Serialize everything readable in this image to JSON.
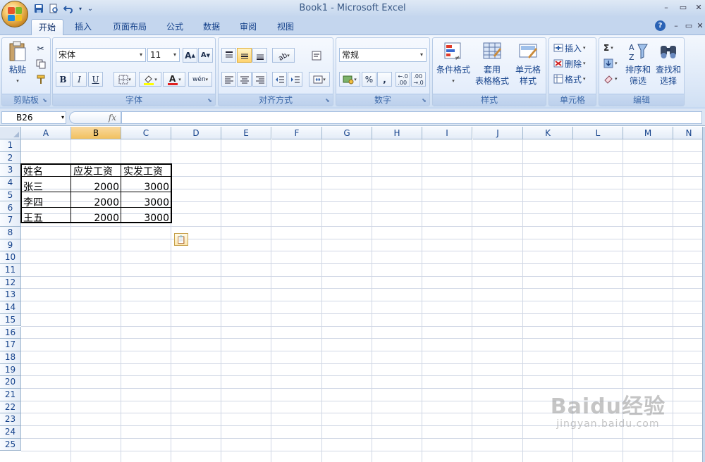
{
  "window": {
    "title": "Book1 - Microsoft Excel",
    "controls": [
      "–",
      "▭",
      "✕"
    ],
    "ribbon_controls": [
      "?",
      "–",
      "▭",
      "✕"
    ]
  },
  "quick_access": [
    "save-icon",
    "print-preview-icon",
    "undo-icon",
    "customize-icon"
  ],
  "tabs": [
    "开始",
    "插入",
    "页面布局",
    "公式",
    "数据",
    "审阅",
    "视图"
  ],
  "active_tab": "开始",
  "ribbon": {
    "clipboard": {
      "label": "剪贴板",
      "paste": "粘贴"
    },
    "font": {
      "label": "字体",
      "name": "宋体",
      "size": "11",
      "bold": "B",
      "italic": "I",
      "underline": "U",
      "grow": "A",
      "shrink": "A",
      "phonetic": "wén"
    },
    "alignment": {
      "label": "对齐方式"
    },
    "number": {
      "label": "数字",
      "format": "常规",
      "percent": "%",
      "comma": ","
    },
    "styles": {
      "label": "样式",
      "conditional": "条件格式",
      "table_format_1": "套用",
      "table_format_2": "表格格式",
      "cell_styles_1": "单元格",
      "cell_styles_2": "样式"
    },
    "cells": {
      "label": "单元格",
      "insert": "插入",
      "delete": "删除",
      "format": "格式"
    },
    "editing": {
      "label": "编辑",
      "sort_1": "排序和",
      "sort_2": "筛选",
      "find_1": "查找和",
      "find_2": "选择",
      "sum": "Σ"
    }
  },
  "formula_bar": {
    "name_box": "B26",
    "fx": "fx",
    "value": ""
  },
  "columns": [
    "A",
    "B",
    "C",
    "D",
    "E",
    "F",
    "G",
    "H",
    "I",
    "J",
    "K",
    "L",
    "M",
    "N"
  ],
  "selected_column": "B",
  "rows": [
    "1",
    "2",
    "3",
    "4",
    "5",
    "6",
    "7",
    "8",
    "9",
    "10",
    "11",
    "12",
    "13",
    "14",
    "15",
    "16",
    "17",
    "18",
    "19",
    "20",
    "21",
    "22",
    "23",
    "24",
    "25"
  ],
  "table": {
    "headers": [
      "姓名",
      "应发工资",
      "实发工资"
    ],
    "rows": [
      [
        "张三",
        "2000",
        "3000"
      ],
      [
        "李四",
        "2000",
        "3000"
      ],
      [
        "王五",
        "2000",
        "3000"
      ]
    ]
  },
  "watermark": {
    "line1": "Baidu经验",
    "line2": "jingyan.baidu.com"
  }
}
